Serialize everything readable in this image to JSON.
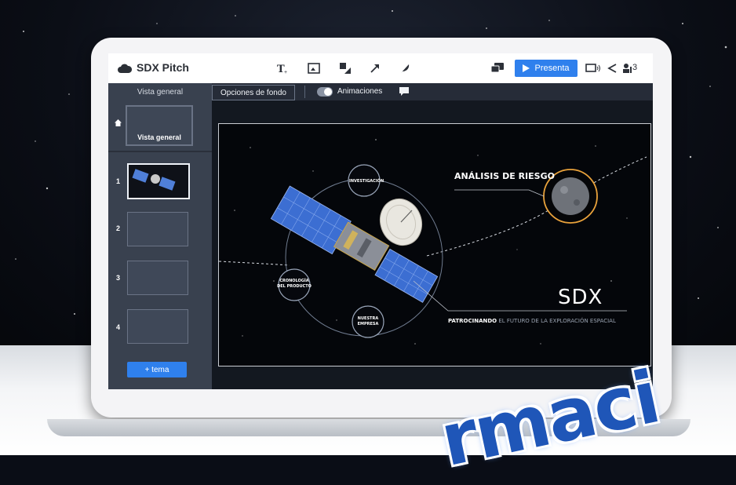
{
  "app": {
    "title": "SDX Pitch"
  },
  "toolbar": {
    "present_label": "Presenta",
    "share_count": "3",
    "icons": [
      "text-add-icon",
      "image-icon",
      "shapes-icon",
      "arrow-icon",
      "feather-icon",
      "comment-icon",
      "present-play-icon",
      "screen-audio-icon",
      "share-icon",
      "users-icon"
    ]
  },
  "subbar": {
    "overview_tab": "Vista general",
    "background_options": "Opciones de fondo",
    "animations_label": "Animaciones"
  },
  "sidebar": {
    "overview_label": "Vista general",
    "slides": [
      {
        "number": "1"
      },
      {
        "number": "2"
      },
      {
        "number": "3"
      },
      {
        "number": "4"
      }
    ],
    "add_topic_label": "+ tema"
  },
  "slide": {
    "risk_title": "ANÁLISIS DE RIESGO",
    "circle_research": "INVESTIGACIÓN",
    "circle_timeline_line1": "CRONOLOGÍA",
    "circle_timeline_line2": "DEL PRODUCTO",
    "circle_company_line1": "NUESTRA",
    "circle_company_line2": "EMPRESA",
    "brand": "SDX",
    "tagline_bold": "PATROCINANDO",
    "tagline_rest": " EL FUTURO DE LA EXPLORACIÓN ESPACIAL"
  },
  "watermark": "rmaci",
  "colors": {
    "accent": "#2f80ed",
    "sidebar": "#39414f",
    "orbit_orange": "#e9a23b"
  }
}
